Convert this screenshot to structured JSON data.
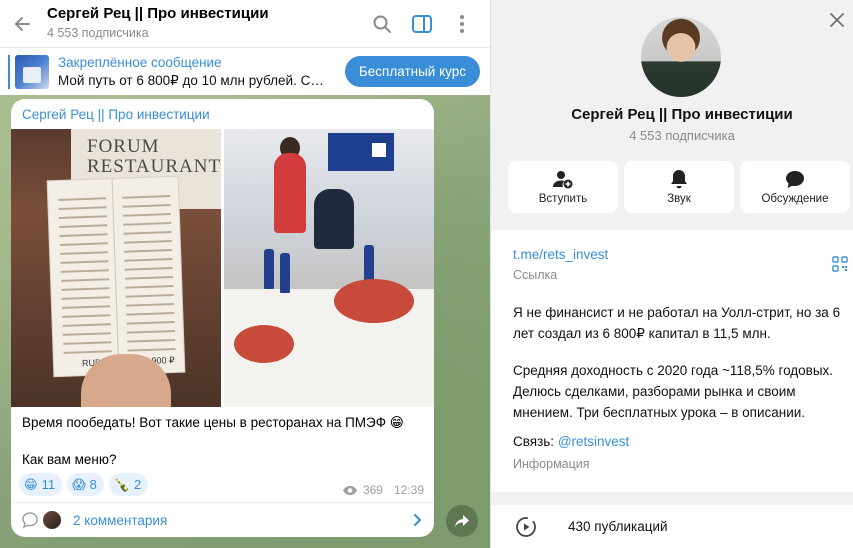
{
  "chat": {
    "title": "Сергей Рец || Про инвестиции",
    "subscribers": "4 553 подписчика",
    "icons": [
      "back-arrow-icon",
      "search-icon",
      "sidebar-toggle-icon",
      "more-vertical-icon"
    ]
  },
  "pinned": {
    "label": "Закреплённое сообщение",
    "message": "Мой путь от 6 800₽ до 10 млн рублей. Сле...",
    "button": "Бесплатный курс"
  },
  "post": {
    "author": "Сергей Рец || Про инвестиции",
    "photo1": {
      "sign": "FORUM RESTAURANT",
      "price_left": "RUB 7,900",
      "price_right": "7 900 ₽"
    },
    "text_line1": "Время пообедать! Вот такие цены в ресторанах на ПМЭФ 😁",
    "text_line2": "Как вам меню?",
    "reactions": [
      {
        "emoji": "😁",
        "count": "11"
      },
      {
        "emoji": "😱",
        "count": "8"
      },
      {
        "emoji": "🍾",
        "count": "2"
      }
    ],
    "views": "369",
    "time": "12:39",
    "comments": "2 комментария"
  },
  "profile": {
    "name": "Сергей Рец || Про инвестиции",
    "subscribers": "4 553 подписчика",
    "actions": [
      {
        "label": "Вступить",
        "icon": "add-user-icon"
      },
      {
        "label": "Звук",
        "icon": "bell-icon"
      },
      {
        "label": "Обсуждение",
        "icon": "chat-bubble-icon"
      }
    ],
    "link": "t.me/rets_invest",
    "link_label": "Ссылка",
    "description_p1": "Я не финансист и не работал на Уолл-стрит, но за 6 лет создал из 6 800₽ капитал в 11,5 млн.",
    "description_p2": "Средняя доходность с 2020 года ~118,5% годовых. Делюсь сделками, разборами рынка и своим мнением. Три бесплатных урока – в описании.",
    "contact_prefix": "Связь: ",
    "contact_handle": "@retsinvest",
    "contact_label": "Информация",
    "publications": "430 публикаций"
  },
  "colors": {
    "accent": "#3a8ed8",
    "chat_background": "#8fa883",
    "panel_background": "#f1f1f3"
  }
}
